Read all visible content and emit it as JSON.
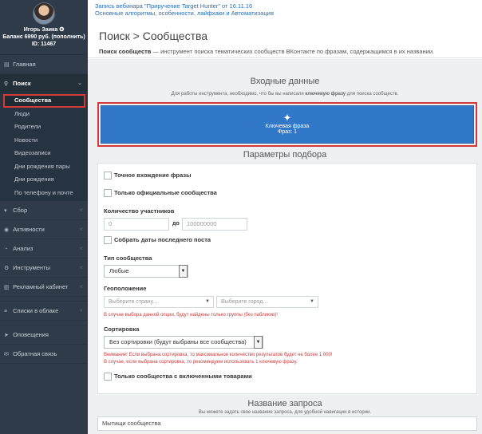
{
  "profile": {
    "name": "Игорь Заика ✪",
    "balance": "Баланс 6990 руб. (пополнить)",
    "id": "ID: 11467"
  },
  "nav": {
    "home": "Главная",
    "search": "Поиск",
    "search_sub": [
      "Сообщества",
      "Люди",
      "Родители",
      "Новости",
      "Видеозаписи",
      "Дни рождения пары",
      "Дни рождения",
      "По телефону и почте"
    ],
    "collect": "Сбор",
    "activity": "Активности",
    "analysis": "Анализ",
    "tools": "Инструменты",
    "ads": "Рекламный кабинет",
    "cloud": "Списки в облаке",
    "alerts": "Оповещения",
    "feedback": "Обратная связь"
  },
  "webinar": {
    "line1": "Запись вебинара \"Приручение Target Hunter\" от 16.11.16",
    "line2": "Основные алгоритмы, особенности, лайфхаки и Автоматизация"
  },
  "header": {
    "title": "Поиск > Сообщества",
    "desc_bold": "Поиск сообществ",
    "desc_rest": " — инструмент поиска тематических сообществ ВКонтакте по фразам, содержащимся в их названии."
  },
  "input_section": {
    "title": "Входные данные",
    "hint_pre": "Для работы инструмента, необходимо, что бы вы написали ",
    "hint_bold": "ключевую фразу",
    "hint_post": " для поиска сообществ.",
    "kw_label": "Ключевая фраза",
    "kw_count": "Фраз: 1"
  },
  "params": {
    "title": "Параметры подбора",
    "exact": "Точное вхождение фразы",
    "official": "Только официальные сообщества",
    "members_label": "Количество участников",
    "min_placeholder": "0",
    "to_label": "до",
    "max_placeholder": "100000000",
    "collect_dates": "Собрать даты последнего поста",
    "type_label": "Тип сообщества",
    "type_value": "Любые",
    "geo_label": "Геоположение",
    "country_placeholder": "Выберите страну...",
    "city_placeholder": "Выберите город...",
    "geo_warn": "В случае выбора данной опции, будут найдены только группы (без пабликов)!",
    "sort_label": "Сортировка",
    "sort_value": "Без сортировки (будут выбраны все сообщества)",
    "sort_warn1": "Внимание! Если выбрана сортировка, то максимальное количество результатов будет не более 1 000!",
    "sort_warn2": "В случае, если выбрана сортировка, то рекомендуем использовать 1 ключевую фразу.",
    "goods": "Только сообщества с включенными товарами"
  },
  "request": {
    "title": "Название запроса",
    "hint": "Вы можете задать свое название запроса, для удобной навигации в истории.",
    "value": "Мытищи сообщества"
  }
}
